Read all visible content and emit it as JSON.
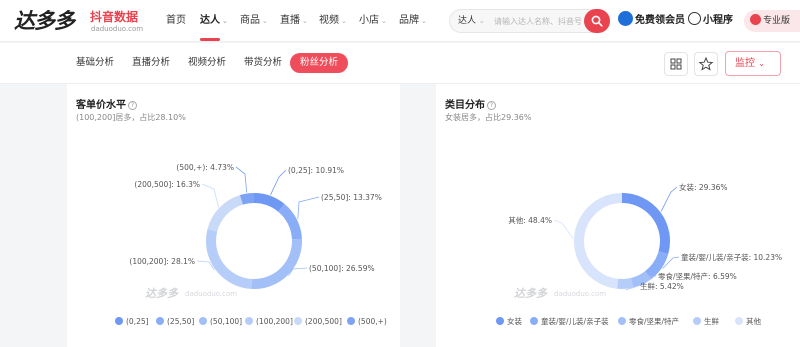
{
  "brand": {
    "name": "达多多",
    "name_cn": "抖音数据",
    "domain": "daduoduo.com"
  },
  "nav": {
    "items": [
      {
        "label": "首页",
        "has_menu": false
      },
      {
        "label": "达人",
        "has_menu": true,
        "active": true
      },
      {
        "label": "商品",
        "has_menu": true
      },
      {
        "label": "直播",
        "has_menu": true
      },
      {
        "label": "视频",
        "has_menu": true
      },
      {
        "label": "小店",
        "has_menu": true
      },
      {
        "label": "品牌",
        "has_menu": true
      }
    ],
    "search": {
      "category": "达人",
      "placeholder": "请输入达人名称、抖音号"
    },
    "vip_label": "免费领会员",
    "mini_label": "小程序",
    "pro_label": "专业版",
    "accent_color": "#e8434f"
  },
  "subnav": {
    "tabs": [
      {
        "label": "基础分析",
        "active": false
      },
      {
        "label": "直播分析",
        "active": false
      },
      {
        "label": "视频分析",
        "active": false
      },
      {
        "label": "带货分析",
        "active": false
      },
      {
        "label": "粉丝分析",
        "active": true
      }
    ],
    "tools": [
      "grid-icon",
      "star-icon"
    ],
    "monitor_label": "监控"
  },
  "watermark": {
    "brand": "达多多",
    "domain": "daduoduo.com"
  },
  "price_panel": {
    "title": "客单价水平",
    "summary": "(100,200]居多，占比28.10%"
  },
  "category_panel": {
    "title": "类目分布",
    "summary": "女装居多，占比29.36%"
  },
  "chart_data": [
    {
      "type": "pie",
      "donut": true,
      "title": "客单价水平",
      "categories": [
        "(0,25]",
        "(25,50]",
        "(50,100]",
        "(100,200]",
        "(200,500]",
        "(500,+)"
      ],
      "values": [
        10.91,
        13.37,
        26.59,
        28.1,
        16.3,
        4.73
      ],
      "labels": [
        "(0,25]: 10.91%",
        "(25,50]: 13.37%",
        "(50,100]: 26.59%",
        "(100,200]: 28.1%",
        "(200,500]: 16.3%",
        "(500,+): 4.73%"
      ],
      "colors": [
        "#6f97f4",
        "#8aadf7",
        "#a2bff8",
        "#b6cdfa",
        "#c9daf9",
        "#7da3f5"
      ],
      "legend_placement": "bottom"
    },
    {
      "type": "pie",
      "donut": true,
      "title": "类目分布",
      "categories": [
        "女装",
        "童装/婴/儿装/亲子装",
        "零食/坚果/特产",
        "生鲜",
        "其他"
      ],
      "values": [
        29.36,
        10.23,
        6.59,
        5.42,
        48.4
      ],
      "labels": [
        "女装: 29.36%",
        "童装/婴/儿装/亲子装: 10.23%",
        "零食/坚果/特产: 6.59%",
        "生鲜: 5.42%",
        "其他: 48.4%"
      ],
      "colors": [
        "#6f97f4",
        "#8aadf7",
        "#a2bff8",
        "#b6cdfa",
        "#d7e4fb"
      ],
      "legend_placement": "bottom"
    }
  ]
}
